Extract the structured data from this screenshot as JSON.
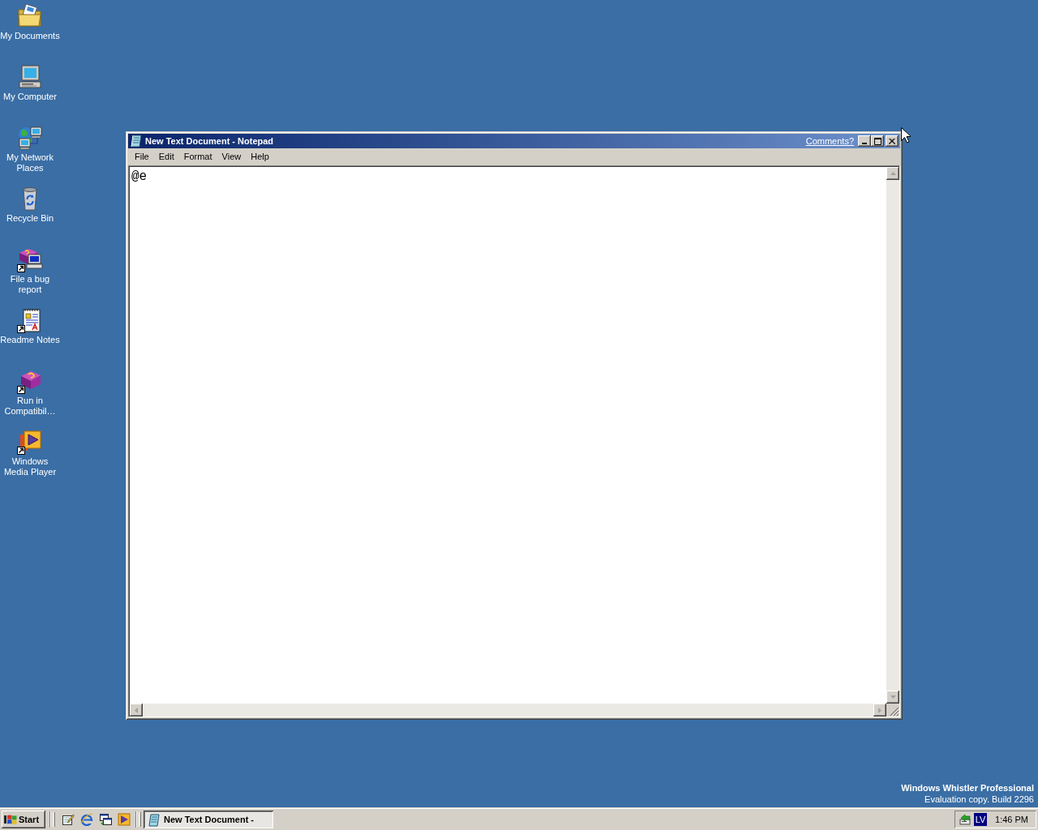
{
  "desktop_icons": [
    {
      "label": "My Documents",
      "kind": "documents",
      "shortcut": false
    },
    {
      "label": "My Computer",
      "kind": "computer",
      "shortcut": false
    },
    {
      "label": "My Network Places",
      "kind": "network",
      "shortcut": false
    },
    {
      "label": "Recycle Bin",
      "kind": "recycle-bin",
      "shortcut": false
    },
    {
      "label": "File a bug report",
      "kind": "bug-report",
      "shortcut": true
    },
    {
      "label": "Readme Notes",
      "kind": "readme",
      "shortcut": true
    },
    {
      "label": "Run in Compatibil…",
      "kind": "compatibility",
      "shortcut": true
    },
    {
      "label": "Windows Media Player",
      "kind": "media-player",
      "shortcut": true
    }
  ],
  "window": {
    "title": "New Text Document - Notepad",
    "link": "Comments?",
    "menu": [
      "File",
      "Edit",
      "Format",
      "View",
      "Help"
    ],
    "content": "@e"
  },
  "watermark": {
    "edition": "Windows Whistler Professional",
    "build": "Evaluation copy. Build 2296"
  },
  "taskbar": {
    "start": "Start",
    "tasks": [
      {
        "label": "New Text Document -",
        "selected": true
      }
    ],
    "tray": {
      "indicator": "LV",
      "clock": "1:46 PM"
    }
  }
}
